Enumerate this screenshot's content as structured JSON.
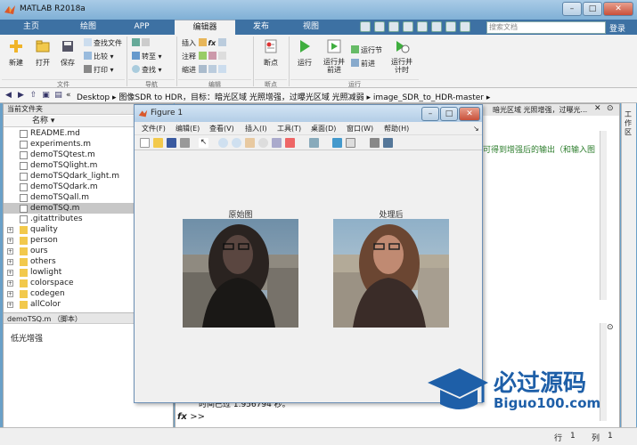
{
  "app": {
    "title": "MATLAB R2018a"
  },
  "window_buttons": {
    "minimize": "–",
    "maximize": "□",
    "close": "✕"
  },
  "tabs": [
    {
      "label": "主页"
    },
    {
      "label": "绘图"
    },
    {
      "label": "APP"
    },
    {
      "label": "编辑器"
    },
    {
      "label": "发布"
    },
    {
      "label": "视图"
    }
  ],
  "search": {
    "placeholder": "搜索文档",
    "login": "登录"
  },
  "ribbon": {
    "file": {
      "new": "新建",
      "open": "打开",
      "save": "保存",
      "find_files": "查找文件",
      "compare": "比较",
      "print": "打印",
      "group": "文件"
    },
    "nav": {
      "goto": "转至",
      "find": "查找",
      "group": "导航"
    },
    "edit": {
      "insert": "插入",
      "comment": "注释",
      "indent": "缩进",
      "fx": "fx",
      "group": "编辑"
    },
    "breakpoint": {
      "label": "断点",
      "group": "断点"
    },
    "run": {
      "run": "运行",
      "run_advance": "运行并\n前进",
      "run_section": "运行节",
      "advance": "前进",
      "run_time": "运行并\n计时",
      "group": "运行"
    }
  },
  "address": {
    "prefix": "«",
    "path": "Desktop ▸ 图像SDR to HDR，目标：暗光区域 光照增强，过曝光区域 光照减弱 ▸ image_SDR_to_HDR-master ▸"
  },
  "left_panel": {
    "header": "当前文件夹",
    "column": "名称 ▾",
    "files": [
      {
        "name": "README.md",
        "type": "file",
        "selected": false
      },
      {
        "name": "experiments.m",
        "type": "file",
        "selected": false
      },
      {
        "name": "demoTSQtest.m",
        "type": "file",
        "selected": false
      },
      {
        "name": "demoTSQlight.m",
        "type": "file",
        "selected": false
      },
      {
        "name": "demoTSQdark_light.m",
        "type": "file",
        "selected": false
      },
      {
        "name": "demoTSQdark.m",
        "type": "file",
        "selected": false
      },
      {
        "name": "demoTSQall.m",
        "type": "file",
        "selected": false
      },
      {
        "name": "demoTSQ.m",
        "type": "file",
        "selected": true
      },
      {
        "name": ".gitattributes",
        "type": "file",
        "selected": false
      },
      {
        "name": "quality",
        "type": "folder",
        "selected": false
      },
      {
        "name": "person",
        "type": "folder",
        "selected": false
      },
      {
        "name": "ours",
        "type": "folder",
        "selected": false
      },
      {
        "name": "others",
        "type": "folder",
        "selected": false
      },
      {
        "name": "lowlight",
        "type": "folder",
        "selected": false
      },
      {
        "name": "colorspace",
        "type": "folder",
        "selected": false
      },
      {
        "name": "codegen",
        "type": "folder",
        "selected": false
      },
      {
        "name": "allColor",
        "type": "folder",
        "selected": false
      }
    ],
    "detail_header": "demoTSQ.m （脚本）",
    "detail_text": "低光增强"
  },
  "right_panel": {
    "path_tail": "暗光区域 光照增强，过曝光...",
    "editor_comment": "可得到增强后的输出（和输入图",
    "cmd_output": "时间已过 1.956794 秒。",
    "prompt_fx": "fx",
    "prompt": ">>"
  },
  "side_tab": {
    "label": "工作区"
  },
  "status": {
    "row_label": "行",
    "row": "1",
    "col_label": "列",
    "col": "1"
  },
  "figure": {
    "title": "Figure 1",
    "menu": [
      "文件(F)",
      "编辑(E)",
      "查看(V)",
      "插入(I)",
      "工具(T)",
      "桌面(D)",
      "窗口(W)",
      "帮助(H)"
    ],
    "left_title": "原始图",
    "right_title": "处理后"
  },
  "watermark": {
    "main": "必过源码",
    "sub": "Biguo100.com"
  },
  "colors": {
    "titlebar": "#7fb0d6",
    "tabbar": "#3d71a3",
    "ribbon": "#f2f2f2",
    "selected_row": "#c7c7c7",
    "folder": "#f2c94c",
    "watermark_blue": "#1e5fa8"
  }
}
